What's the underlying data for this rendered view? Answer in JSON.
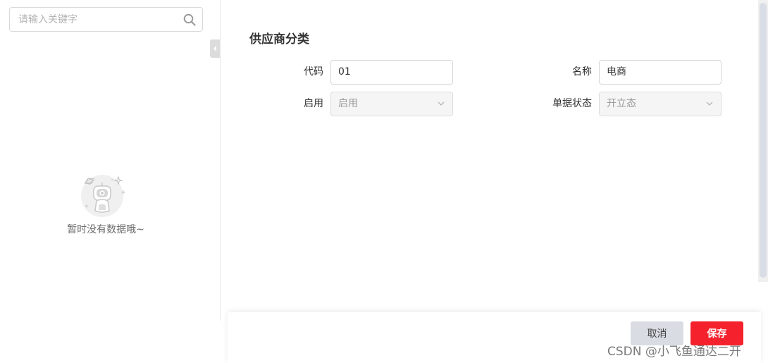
{
  "sidebar": {
    "search": {
      "placeholder": "请输入关键字",
      "value": ""
    },
    "empty_text": "暂时没有数据哦~"
  },
  "form": {
    "title": "供应商分类",
    "fields": {
      "code": {
        "label": "代码",
        "value": "01"
      },
      "name": {
        "label": "名称",
        "value": "电商"
      },
      "enabled": {
        "label": "启用",
        "value": "启用"
      },
      "doc_status": {
        "label": "单据状态",
        "value": "开立态"
      }
    }
  },
  "footer": {
    "cancel_label": "取消",
    "save_label": "保存"
  },
  "watermark": "CSDN @小飞鱼通达二开",
  "colors": {
    "primary": "#f5222d",
    "cancel_bg": "#d9dde3",
    "border": "#d6d6d6",
    "disabled_bg": "#f5f5f5"
  },
  "icons": {
    "search": "search-icon",
    "collapse": "caret-left-icon",
    "select": "chevron-down-icon",
    "empty": "empty-robot-illustration"
  }
}
